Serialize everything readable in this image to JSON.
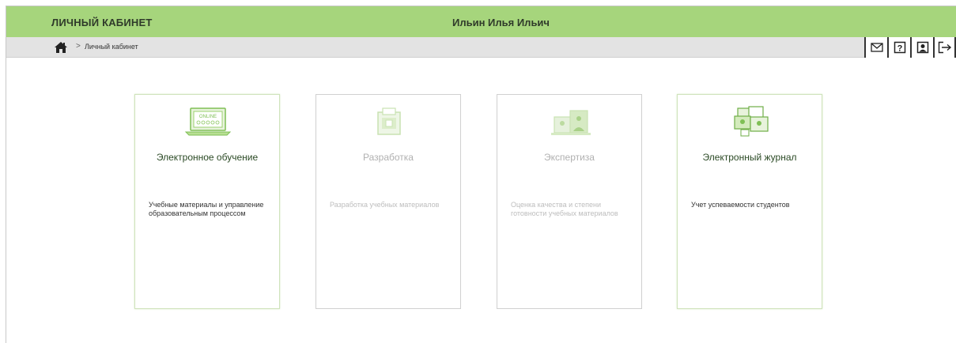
{
  "header": {
    "title": "ЛИЧНЫЙ КАБИНЕТ",
    "user_name": "Ильин Илья Ильич"
  },
  "breadcrumb": {
    "separator": ">",
    "current": "Личный кабинет"
  },
  "toolbar": {
    "icons": [
      "envelope-icon",
      "help-icon",
      "profile-icon",
      "logout-icon"
    ],
    "help_glyph": "?"
  },
  "tiles": [
    {
      "title": "Электронное обучение",
      "description": "Учебные материалы и управление образовательным процессом",
      "illustration_label": "ONLINE",
      "state": "active"
    },
    {
      "title": "Разработка",
      "description": "Разработка учебных материалов",
      "state": "disabled"
    },
    {
      "title": "Экспертиза",
      "description": "Оценка качества и степени готовности учебных материалов",
      "state": "disabled"
    },
    {
      "title": "Электронный журнал",
      "description": "Учет успеваемости студентов",
      "state": "active"
    }
  ],
  "colors": {
    "header_bg": "#a6d57c",
    "breadcrumb_bg": "#e3e3e3",
    "tile_title": "#2b4a25",
    "disabled_text": "#b0b0b0"
  }
}
